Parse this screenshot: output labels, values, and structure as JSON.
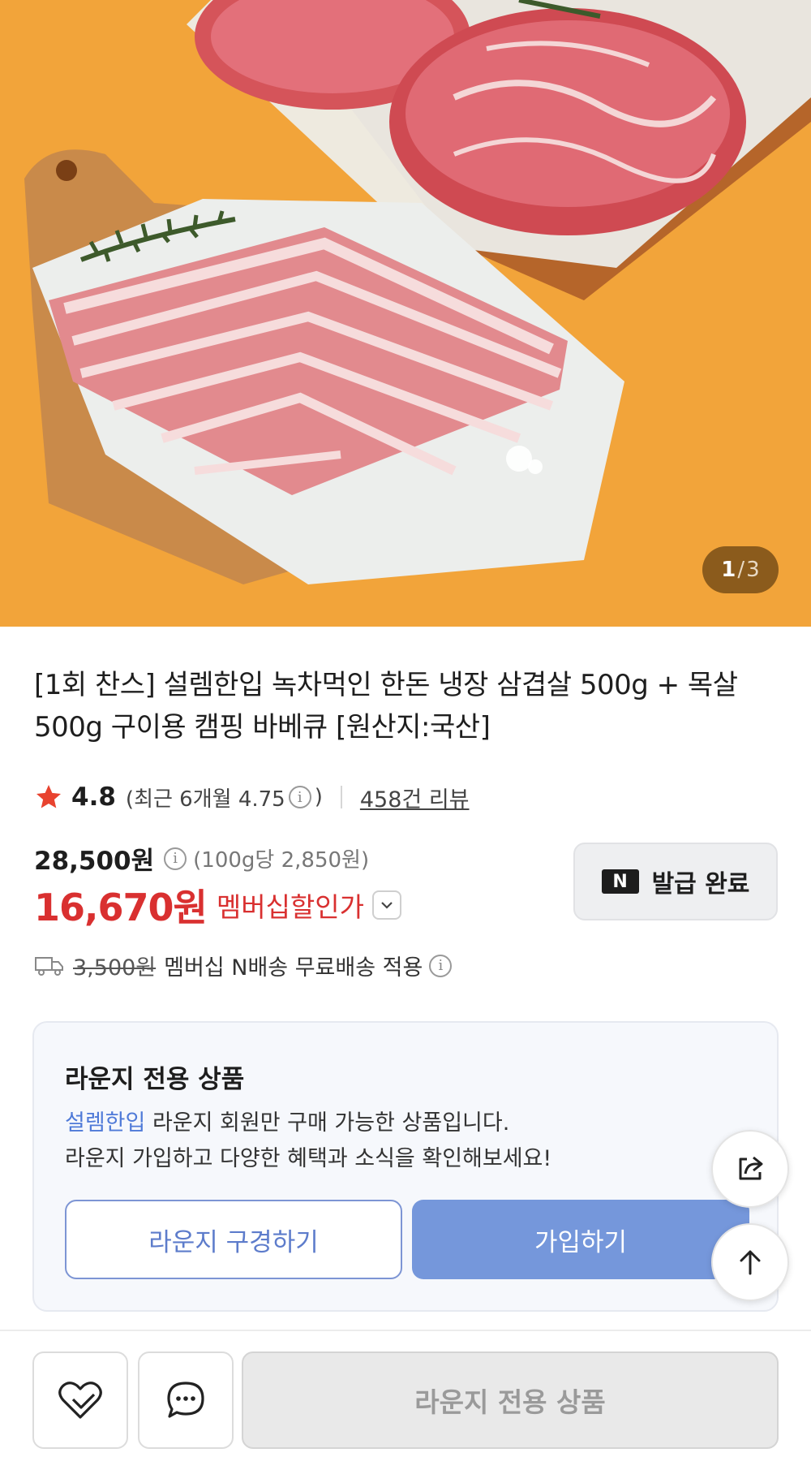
{
  "hero": {
    "page_current": "1",
    "page_separator": "/",
    "page_total": "3"
  },
  "product": {
    "title": "[1회 찬스] 설렘한입 녹차먹인 한돈 냉장 삼겹살 500g + 목살 500g 구이용 캠핑 바베큐 [원산지:국산]",
    "rating": "4.8",
    "rating_recent": "(최근 6개월 4.75",
    "rating_recent_close": ")",
    "review_count": "458건 리뷰",
    "price_original": "28,500원",
    "price_unit": "(100g당 2,850원)",
    "price_sale": "16,670원",
    "price_sale_label": "멤버십할인가",
    "coupon_badge": "N",
    "coupon_label": "발급 완료",
    "shipping_fee": "3,500원",
    "shipping_text": "멤버십 N배송 무료배송 적용"
  },
  "lounge": {
    "title": "라운지 전용 상품",
    "store_name": "설렘한입",
    "desc_line1": " 라운지 회원만 구매 가능한 상품입니다.",
    "desc_line2": "라운지 가입하고 다양한 혜택과 소식을 확인해보세요!",
    "browse_label": "라운지 구경하기",
    "join_label": "가입하기"
  },
  "bottom_bar": {
    "main_label": "라운지 전용 상품"
  },
  "icons": {
    "star": "star-icon",
    "info": "info-icon",
    "truck": "truck-icon",
    "share": "share-icon",
    "arrow_up": "arrow-up-icon",
    "heart": "heart-icon",
    "chat": "chat-icon"
  },
  "colors": {
    "hero_bg": "#f2a43a",
    "sale_red": "#d93030",
    "lounge_blue": "#7597db",
    "star": "#e8432f"
  }
}
